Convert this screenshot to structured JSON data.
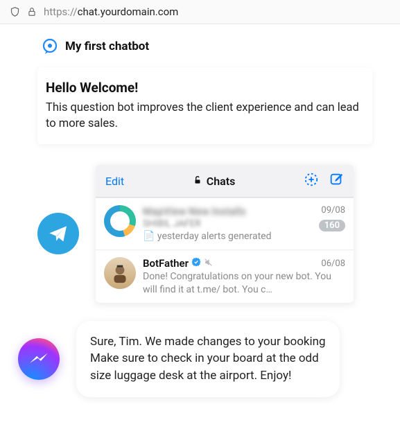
{
  "address_bar": {
    "protocol": "https://",
    "domain": "chat.yourdomain.com"
  },
  "bot_header": {
    "title": "My first chatbot"
  },
  "welcome": {
    "heading": "Hello Welcome!",
    "body": "This question bot improves the client experience and can lead to more sales."
  },
  "chats_panel": {
    "edit_label": "Edit",
    "title": "Chats",
    "items": [
      {
        "name": "MapView New Installs",
        "sub": "SHIBIL JAFER",
        "msg_prefix": "📄",
        "msg": "yesterday alerts generated",
        "date": "09/08",
        "badge": "160"
      },
      {
        "name": "BotFather",
        "verified": true,
        "muted": true,
        "msg": "Done! Congratulations on your new bot. You will find it at t.me/      bot. You c…",
        "date": "06/08"
      }
    ]
  },
  "bubble": {
    "text": "Sure, Tim. We made changes to your booking Make sure to check in your board at the odd size luggage desk at the airport. Enjoy!"
  }
}
